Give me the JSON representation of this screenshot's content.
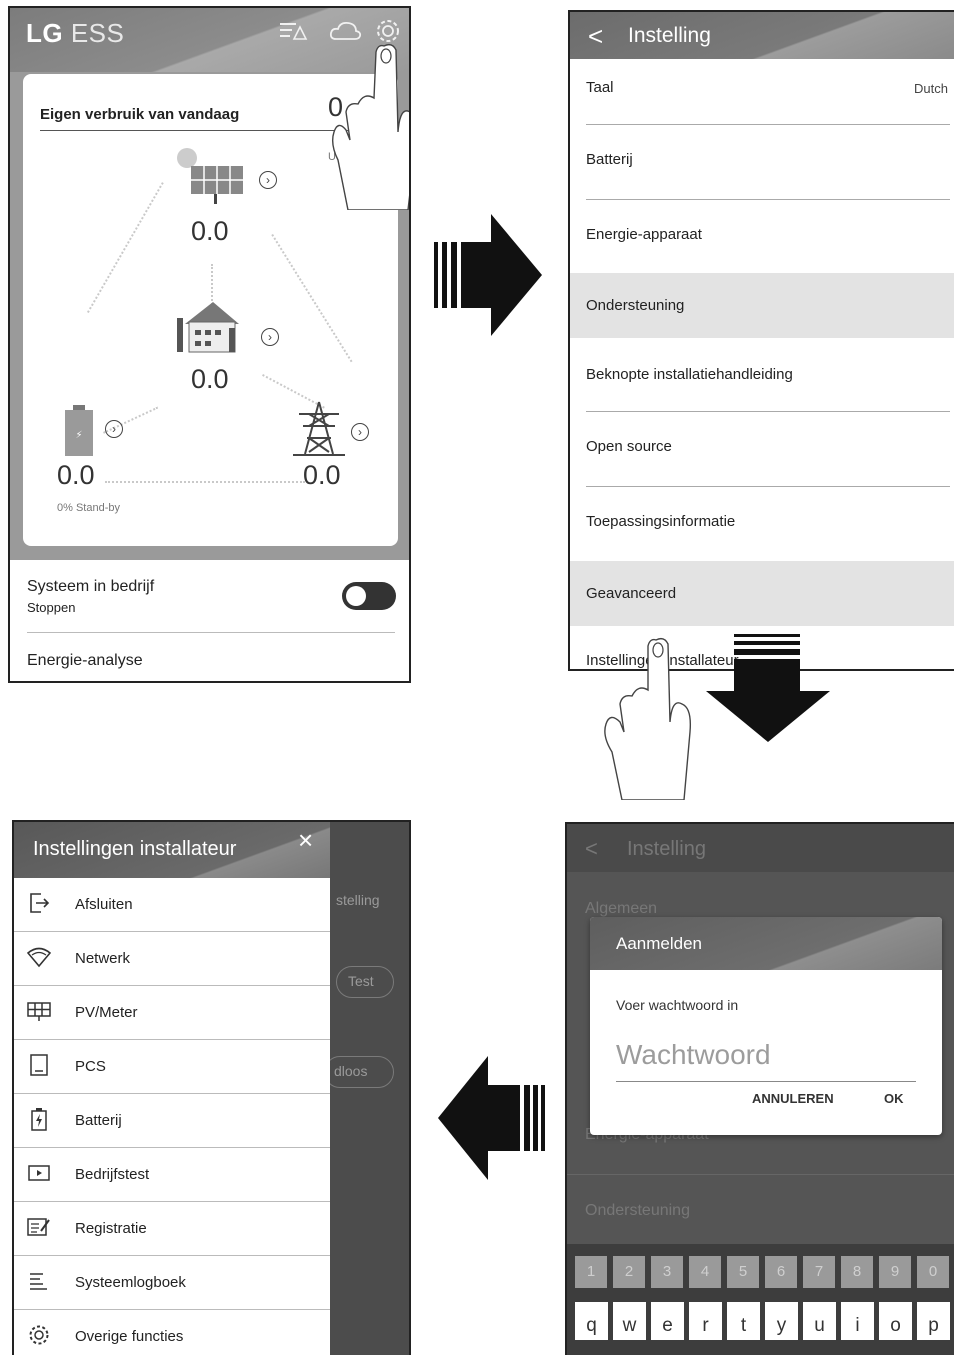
{
  "panel1": {
    "logo_brand": "LG",
    "logo_product": "ESS",
    "card_title": "Eigen verbruik van vandaag",
    "today_value_partial": "0",
    "today_unit_partial": "U",
    "solar_value": "0.0",
    "home_value": "0.0",
    "battery_value": "0.0",
    "battery_status": "0% Stand-by",
    "grid_value": "0.0",
    "system_title": "Systeem in bedrijf",
    "system_status": "Stoppen",
    "energy_analysis": "Energie-analyse",
    "toggle_on": false
  },
  "panel2": {
    "title": "Instelling",
    "back_glyph": "<",
    "rows": [
      {
        "label": "Taal",
        "value": "Dutch"
      },
      {
        "label": "Batterij"
      },
      {
        "label": "Energie-apparaat"
      },
      {
        "label": "Ondersteuning"
      },
      {
        "label": "Beknopte installatiehandleiding"
      },
      {
        "label": "Open source"
      },
      {
        "label": "Toepassingsinformatie"
      },
      {
        "label": "Geavanceerd"
      },
      {
        "label": "Instellingen installateur"
      }
    ]
  },
  "panel3": {
    "title": "Instellingen installateur",
    "close_glyph": "×",
    "items": [
      {
        "label": "Afsluiten",
        "icon": "exit-icon"
      },
      {
        "label": "Netwerk",
        "icon": "wifi-icon"
      },
      {
        "label": "PV/Meter",
        "icon": "solar-panel-icon"
      },
      {
        "label": "PCS",
        "icon": "device-icon"
      },
      {
        "label": "Batterij",
        "icon": "battery-icon"
      },
      {
        "label": "Bedrijfstest",
        "icon": "play-icon"
      },
      {
        "label": "Registratie",
        "icon": "registration-icon"
      },
      {
        "label": "Systeemlogboek",
        "icon": "log-icon"
      },
      {
        "label": "Overige functies",
        "icon": "gear-icon"
      }
    ],
    "bg_instelling": "stelling",
    "bg_test": "Test",
    "bg_draadloos": "dloos"
  },
  "panel4": {
    "bg_title": "Instelling",
    "bg_algemeen": "Algemeen",
    "bg_energie": "Energie-apparaat",
    "bg_ondersteuning": "Ondersteuning",
    "dialog_title": "Aanmelden",
    "dialog_prompt": "Voer wachtwoord in",
    "password_placeholder": "Wachtwoord",
    "cancel_label": "ANNULEREN",
    "ok_label": "OK",
    "digits": [
      "1",
      "2",
      "3",
      "4",
      "5",
      "6",
      "7",
      "8",
      "9",
      "0"
    ],
    "letters": [
      "q",
      "w",
      "e",
      "r",
      "t",
      "y",
      "u",
      "i",
      "o",
      "p"
    ]
  }
}
